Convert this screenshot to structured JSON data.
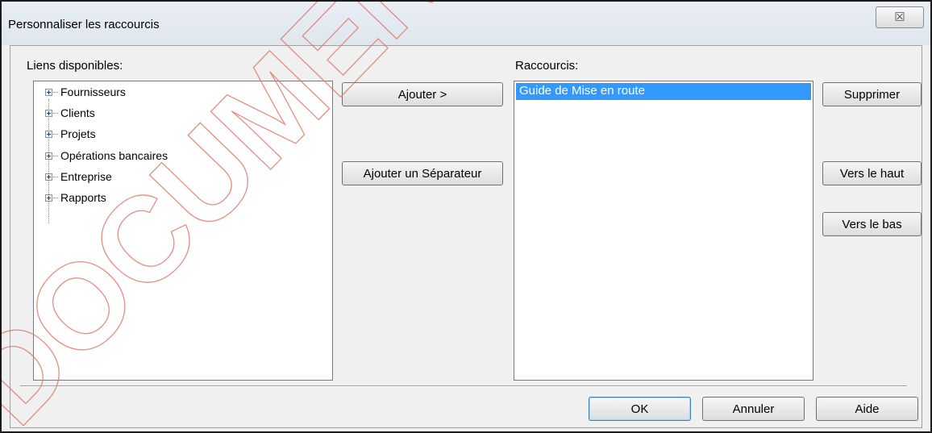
{
  "dialog": {
    "title": "Personnaliser les raccourcis",
    "close_symbol": "☒"
  },
  "available_links": {
    "label": "Liens disponibles:",
    "items": [
      {
        "label": "Fournisseurs"
      },
      {
        "label": "Clients"
      },
      {
        "label": "Projets"
      },
      {
        "label": "Opérations bancaires"
      },
      {
        "label": "Entreprise"
      },
      {
        "label": "Rapports"
      }
    ]
  },
  "center_buttons": {
    "add": "Ajouter >",
    "add_separator": "Ajouter un Séparateur"
  },
  "shortcuts": {
    "label": "Raccourcis:",
    "items": [
      {
        "label": "Guide de Mise en route",
        "selected": true
      }
    ]
  },
  "side_buttons": {
    "delete": "Supprimer",
    "move_up": "Vers le haut",
    "move_down": "Vers le bas"
  },
  "footer_buttons": {
    "ok": "OK",
    "cancel": "Annuler",
    "help": "Aide"
  },
  "watermark": {
    "text": "DOCUMENT COMPTE FA"
  },
  "colors": {
    "selection": "#3399ff",
    "default_button_border": "#3c7fb1"
  }
}
